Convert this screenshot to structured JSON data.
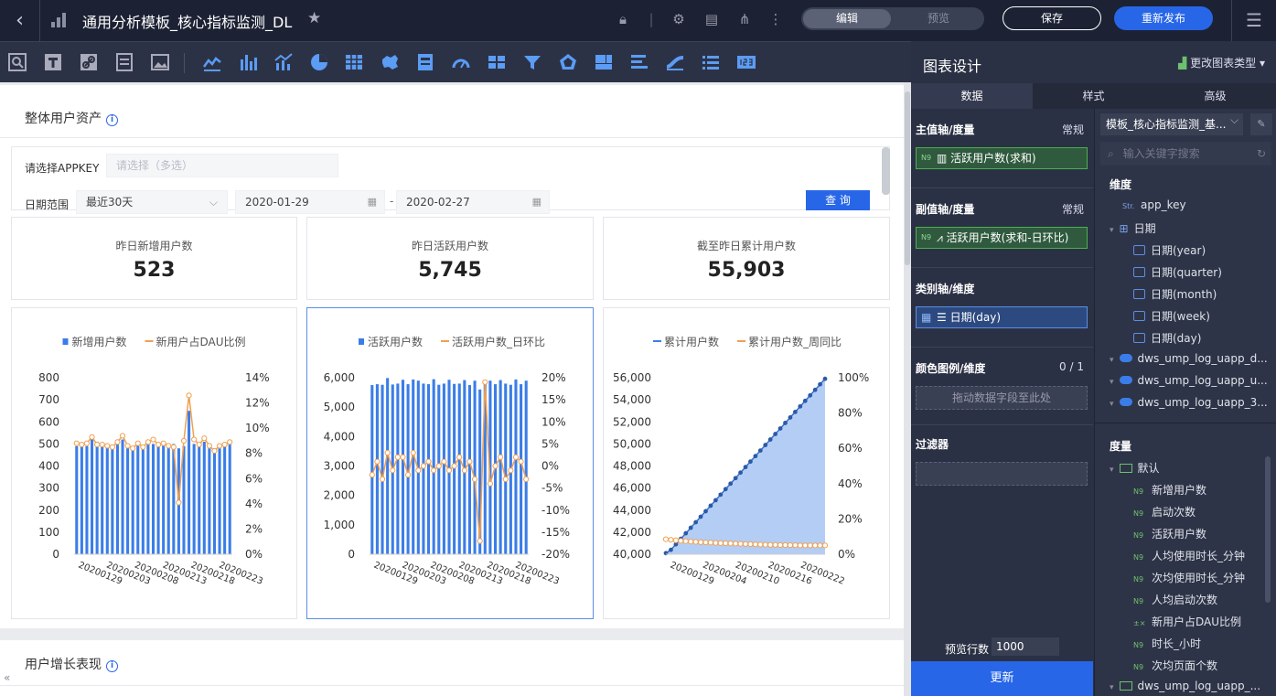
{
  "header": {
    "title": "通用分析模板_核心指标监测_DL",
    "mode_edit": "编辑",
    "mode_preview": "预览",
    "save_label": "保存",
    "republish_label": "重新发布"
  },
  "sections": {
    "s1_title": "整体用户资产",
    "s2_title": "用户增长表现"
  },
  "filters": {
    "appkey_label": "请选择APPKEY",
    "appkey_placeholder": "请选择（多选）",
    "date_label": "日期范围",
    "date_range_value": "最近30天",
    "date_start": "2020-01-29",
    "date_sep": "-",
    "date_end": "2020-02-27",
    "query_label": "查 询"
  },
  "kpis": [
    {
      "label": "昨日新增用户数",
      "value": "523"
    },
    {
      "label": "昨日活跃用户数",
      "value": "5,745"
    },
    {
      "label": "截至昨日累计用户数",
      "value": "55,903"
    }
  ],
  "chart_data": [
    {
      "type": "bar",
      "series": [
        {
          "name": "新增用户数",
          "kind": "bar",
          "axis": "left",
          "color": "#3b7de8",
          "values": [
            490,
            500,
            490,
            540,
            510,
            500,
            490,
            480,
            510,
            520,
            490,
            480,
            500,
            490,
            510,
            500,
            490,
            495,
            485,
            500,
            480,
            490,
            650,
            500,
            490,
            510,
            480,
            470,
            480,
            490,
            510
          ]
        },
        {
          "name": "新用户占DAU比例",
          "kind": "line",
          "axis": "right",
          "color": "#f0a050",
          "values": [
            8.8,
            8.7,
            8.8,
            9.3,
            8.7,
            8.7,
            8.6,
            8.5,
            8.9,
            9.4,
            8.6,
            8.4,
            8.8,
            8.5,
            8.9,
            9.1,
            8.7,
            8.8,
            8.6,
            8.5,
            4.1,
            9.0,
            12.6,
            9.1,
            8.7,
            9.2,
            8.6,
            8.2,
            8.6,
            8.7,
            8.9
          ]
        }
      ],
      "y_left": {
        "min": 0,
        "max": 800,
        "ticks": [
          "0",
          "100",
          "200",
          "300",
          "400",
          "500",
          "600",
          "700",
          "800"
        ]
      },
      "y_right": {
        "min": 0,
        "max": 14,
        "ticks": [
          "0%",
          "2%",
          "4%",
          "6%",
          "8%",
          "10%",
          "12%",
          "14%"
        ]
      },
      "x_ticks": [
        "20200129",
        "20200203",
        "20200208",
        "20200213",
        "20200218",
        "20200223"
      ]
    },
    {
      "type": "bar",
      "series": [
        {
          "name": "活跃用户数",
          "kind": "bar",
          "axis": "left",
          "color": "#3b7de8",
          "values": [
            5750,
            5780,
            5760,
            5990,
            5770,
            5800,
            5930,
            5780,
            5940,
            5900,
            5800,
            5780,
            5950,
            5760,
            5800,
            5930,
            5790,
            5800,
            5920,
            5750,
            5900,
            5600,
            5800,
            5900,
            5780,
            5920,
            5800,
            5760,
            5940,
            5780,
            5900
          ]
        },
        {
          "name": "活跃用户数_日环比",
          "kind": "line",
          "axis": "right",
          "color": "#f0a050",
          "values": [
            -2,
            1,
            -3,
            3,
            -1,
            2,
            2,
            -2,
            3,
            -1,
            0,
            1,
            -1,
            0,
            1,
            -1,
            0,
            2,
            -1,
            1,
            -3,
            -17,
            19,
            -4,
            0,
            2,
            -3,
            -1,
            2,
            1,
            -3
          ]
        }
      ],
      "y_left": {
        "min": 0,
        "max": 6000,
        "ticks": [
          "0",
          "1,000",
          "2,000",
          "3,000",
          "4,000",
          "5,000",
          "6,000"
        ]
      },
      "y_right": {
        "min": -20,
        "max": 20,
        "ticks": [
          "-20%",
          "-15%",
          "-10%",
          "-5%",
          "0%",
          "5%",
          "10%",
          "15%",
          "20%"
        ]
      },
      "x_ticks": [
        "20200129",
        "20200203",
        "20200208",
        "20200213",
        "20200218",
        "20200223"
      ]
    },
    {
      "type": "area",
      "series": [
        {
          "name": "累计用户数",
          "kind": "area",
          "axis": "left",
          "color": "#3b7de8",
          "values": [
            40100,
            40400,
            40900,
            41400,
            41900,
            42400,
            42900,
            43400,
            43900,
            44400,
            44900,
            45400,
            45900,
            46400,
            46900,
            47400,
            47900,
            48400,
            48900,
            49400,
            49900,
            50400,
            50900,
            51400,
            51900,
            52400,
            52900,
            53400,
            53900,
            54400,
            54900,
            55400,
            55903
          ]
        },
        {
          "name": "累计用户数_周同比",
          "kind": "line",
          "axis": "right",
          "color": "#f0a050",
          "values": [
            8.5,
            8.2,
            7.9,
            7.6,
            7.4,
            7.2,
            7.0,
            6.8,
            6.7,
            6.6,
            6.4,
            6.3,
            6.2,
            6.1,
            6.0,
            5.9,
            5.8,
            5.7,
            5.6,
            5.5,
            5.4,
            5.3,
            5.3,
            5.2,
            5.2,
            5.1,
            5.1,
            5.0,
            5.0,
            5.0,
            5.0,
            5.0,
            5.0
          ]
        }
      ],
      "y_left": {
        "min": 40000,
        "max": 56000,
        "ticks": [
          "40,000",
          "42,000",
          "44,000",
          "46,000",
          "48,000",
          "50,000",
          "52,000",
          "54,000",
          "56,000"
        ]
      },
      "y_right": {
        "min": 0,
        "max": 100,
        "ticks": [
          "0%",
          "20%",
          "40%",
          "60%",
          "80%",
          "100%"
        ]
      },
      "x_ticks": [
        "20200129",
        "20200204",
        "20200210",
        "20200216",
        "20200222"
      ]
    }
  ],
  "design": {
    "title": "图表设计",
    "change_type": "更改图表类型",
    "tabs": [
      "数据",
      "样式",
      "高级"
    ],
    "main_axis": "主值轴/度量",
    "main_axis_mode": "常规",
    "main_field": "活跃用户数(求和)",
    "sub_axis": "副值轴/度量",
    "sub_axis_mode": "常规",
    "sub_field": "活跃用户数(求和-日环比)",
    "category_axis": "类别轴/维度",
    "category_field": "日期(day)",
    "color_legend": "颜色图例/维度",
    "color_count": "0 / 1",
    "drop_hint": "拖动数据字段至此处",
    "filter": "过滤器",
    "preview_rows_label": "预览行数",
    "preview_rows_value": "1000",
    "update_label": "更新"
  },
  "datasource": {
    "selected": "模板_核心指标监测_基...",
    "search_placeholder": "输入关键字搜索",
    "dim_header": "维度",
    "dims": [
      "app_key",
      "日期",
      "日期(year)",
      "日期(quarter)",
      "日期(month)",
      "日期(week)",
      "日期(day)",
      "dws_ump_log_uapp_d...",
      "dws_ump_log_uapp_u...",
      "dws_ump_log_uapp_3..."
    ],
    "measure_header": "度量",
    "default_folder": "默认",
    "measures": [
      "新增用户数",
      "启动次数",
      "活跃用户数",
      "人均使用时长_分钟",
      "次均使用时长_分钟",
      "人均启动次数",
      "新用户占DAU比例",
      "时长_小时",
      "次均页面个数"
    ],
    "last_folder": "dws_ump_log_uapp_..."
  }
}
